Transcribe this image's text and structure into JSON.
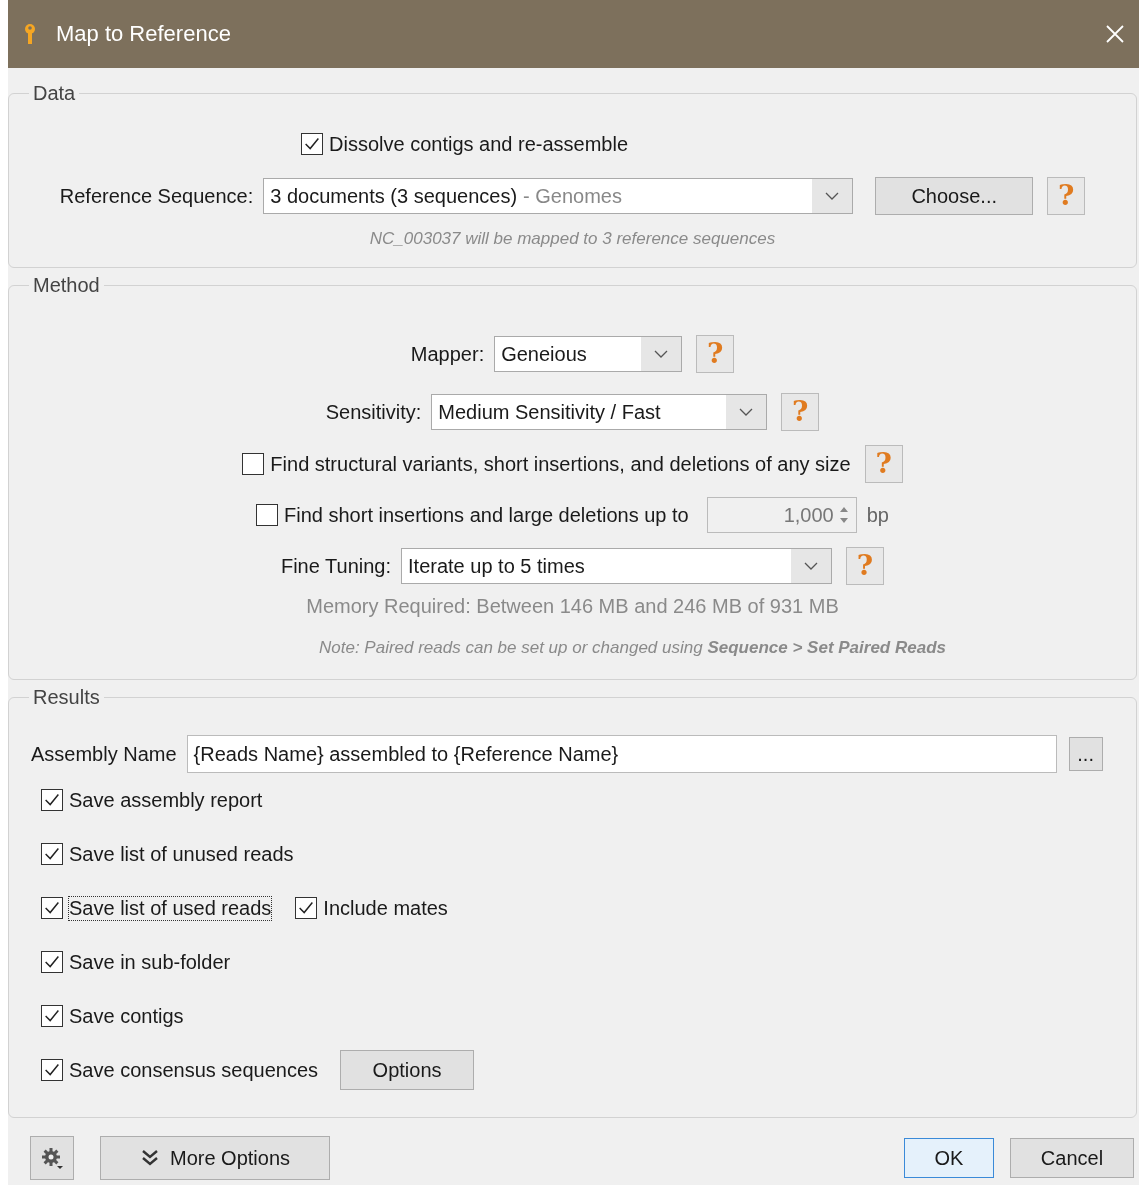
{
  "window": {
    "title": "Map to Reference"
  },
  "data_section": {
    "title": "Data",
    "dissolve": {
      "label": "Dissolve contigs and re-assemble",
      "checked": true
    },
    "reference": {
      "label": "Reference Sequence:",
      "value": "3 documents (3 sequences)",
      "detail": "- Genomes",
      "button": "Choose...",
      "help": "?"
    },
    "note": "NC_003037 will be mapped to 3 reference sequences"
  },
  "method_section": {
    "title": "Method",
    "mapper": {
      "label": "Mapper:",
      "value": "Geneious",
      "help": "?"
    },
    "sensitivity": {
      "label": "Sensitivity:",
      "value": "Medium Sensitivity / Fast",
      "help": "?"
    },
    "structural": {
      "label": "Find structural variants, short insertions, and deletions of any size",
      "checked": false,
      "help": "?"
    },
    "short_insertions": {
      "label": "Find short insertions and large deletions up to",
      "checked": false,
      "value": "1,000",
      "disabled": true,
      "unit": "bp"
    },
    "fine_tuning": {
      "label": "Fine Tuning:",
      "value": "Iterate up to 5 times",
      "help": "?"
    },
    "memory": "Memory Required: Between 146 MB and 246 MB of 931 MB",
    "note": "Note: Paired reads can be set up or changed using **Sequence > Set Paired Reads**"
  },
  "results_section": {
    "title": "Results",
    "assembly_name": {
      "label": "Assembly Name",
      "value": "{Reads Name} assembled to {Reference Name}",
      "button": "..."
    },
    "options": [
      {
        "label": "Save assembly report",
        "checked": true,
        "focused": false
      },
      {
        "label": "Save list of unused reads",
        "checked": true,
        "focused": false
      },
      {
        "label": "Save list of used reads",
        "checked": true,
        "focused": true,
        "extra_checkbox": {
          "label": "Include mates",
          "checked": true
        }
      },
      {
        "label": "Save in sub-folder",
        "checked": true,
        "focused": false
      },
      {
        "label": "Save contigs",
        "checked": true,
        "focused": false
      },
      {
        "label": "Save consensus sequences",
        "checked": true,
        "focused": false,
        "button": "Options"
      }
    ]
  },
  "footer": {
    "more_options": "More Options",
    "buttons": [
      {
        "label": "OK",
        "default": true
      },
      {
        "label": "Cancel",
        "default": false
      }
    ]
  }
}
